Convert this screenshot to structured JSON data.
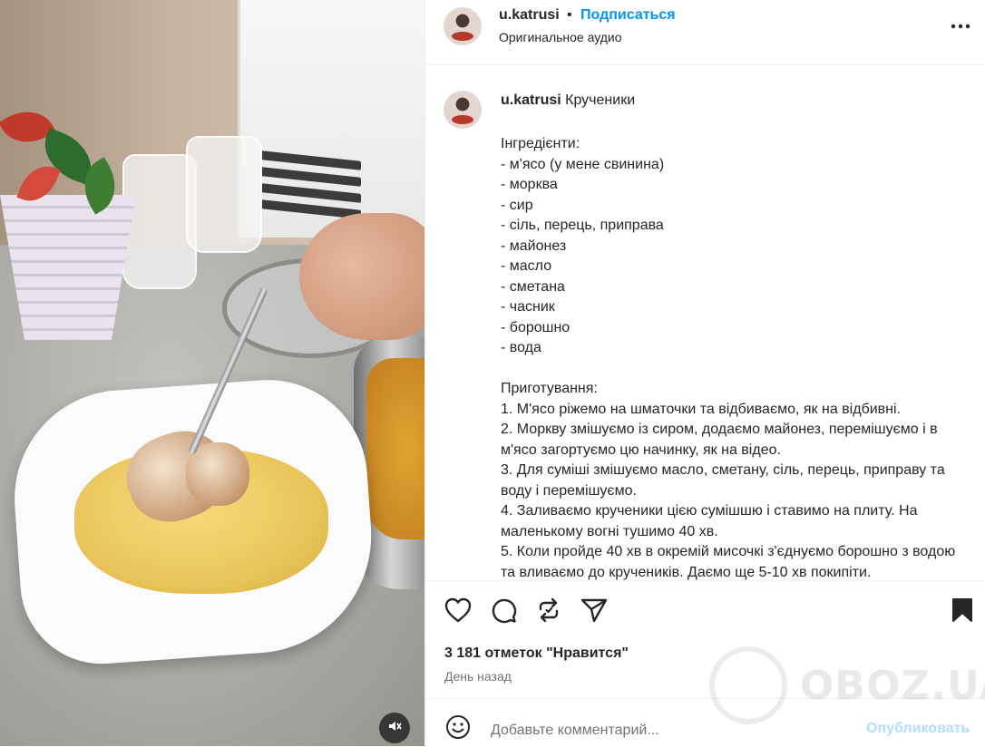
{
  "post": {
    "username": "u.katrusi",
    "separator": "•",
    "follow_label": "Подписаться",
    "audio_label": "Оригинальное аудио",
    "more_icon": "ellipsis-icon"
  },
  "caption": {
    "username": "u.katrusi",
    "title": "Крученики",
    "lines": [
      "Інгредієнти:",
      "- м'ясо (у мене свинина)",
      "- морква",
      "- сир",
      "- сіль, перець, приправа",
      "- майонез",
      "- масло",
      "- сметана",
      "- часник",
      "- борошно",
      "- вода",
      "",
      "Приготування:",
      "1. М'ясо ріжемо на шматочки та відбиваємо, як на відбивні.",
      "2. Моркву змішуємо із сиром, додаємо майонез, перемішуємо і в м'ясо загортуємо цю начинку, як на відео.",
      "3. Для суміші змішуємо масло, сметану, сіль, перець, приправу та воду і перемішуємо.",
      "4. Заливаємо крученики цією сумішшю і ставимо на плиту. На маленькому вогні тушимо 40 хв.",
      "5. Коли пройде 40 хв в окремій мисочкі з'єднуємо борошно з водою та вливаємо до кручеників. Даємо ще 5-10 хв покипіти."
    ]
  },
  "actions": {
    "like_icon": "heart-icon",
    "comment_icon": "comment-icon",
    "share_icon": "repost-icon",
    "send_icon": "send-icon",
    "save_icon": "bookmark-icon"
  },
  "likes_text": "3 181 отметок \"Нравится\"",
  "time_text": "День назад",
  "comment": {
    "placeholder": "Добавьте комментарий...",
    "post_label": "Опубликовать"
  },
  "watermark": {
    "text": "OBOZ.UA"
  },
  "colors": {
    "accent": "#0095f6",
    "post_disabled": "#b3dbff",
    "text": "#262626",
    "muted": "#737373"
  }
}
